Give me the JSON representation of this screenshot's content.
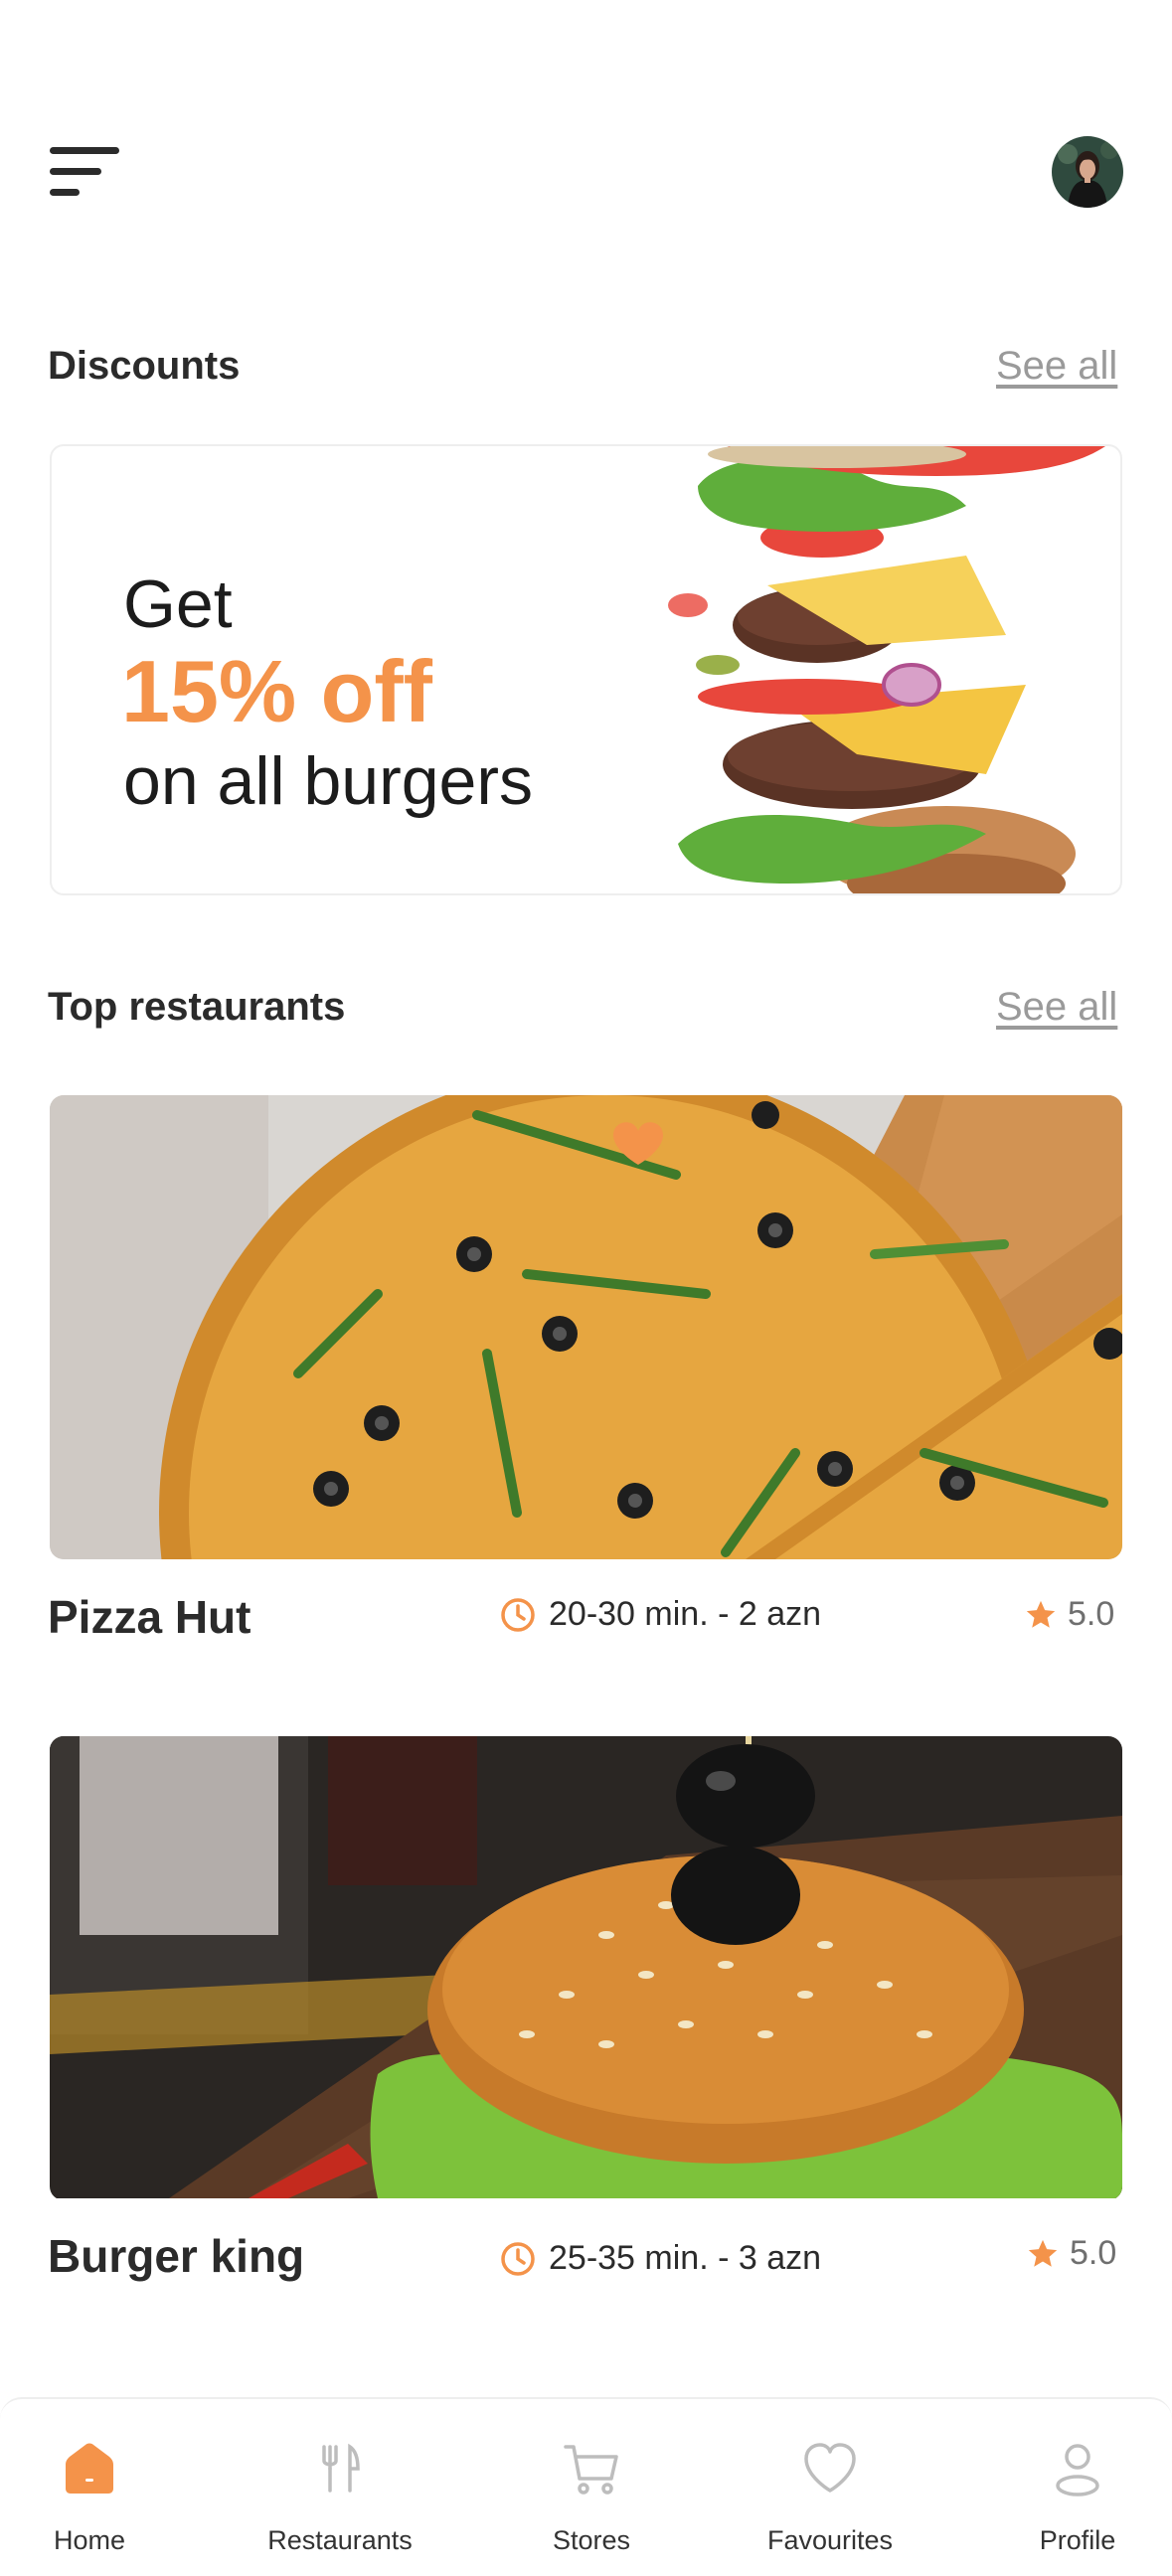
{
  "header": {
    "menu_icon": "hamburger-menu-icon",
    "avatar_icon": "user-avatar"
  },
  "discounts": {
    "title": "Discounts",
    "see_all": "See all",
    "promo": {
      "line1": "Get",
      "line2": "15% off",
      "line3": "on all burgers"
    }
  },
  "top_restaurants": {
    "title": "Top restaurants",
    "see_all": "See all",
    "items": [
      {
        "name": "Pizza Hut",
        "time": "20-30 min. - 2 azn",
        "rating": "5.0",
        "favourite": true
      },
      {
        "name": "Burger king",
        "time": "25-35 min. - 3 azn",
        "rating": "5.0",
        "favourite": false
      }
    ]
  },
  "bottom_nav": [
    {
      "label": "Home",
      "icon": "home-icon",
      "active": true
    },
    {
      "label": "Restaurants",
      "icon": "fork-knife-icon",
      "active": false
    },
    {
      "label": "Stores",
      "icon": "cart-icon",
      "active": false
    },
    {
      "label": "Favourites",
      "icon": "heart-icon",
      "active": false
    },
    {
      "label": "Profile",
      "icon": "user-icon",
      "active": false
    }
  ],
  "colors": {
    "accent": "#f4934a",
    "text": "#2b2b2b",
    "muted": "#9a9a9a",
    "inactive_icon": "#bdbdbd"
  }
}
